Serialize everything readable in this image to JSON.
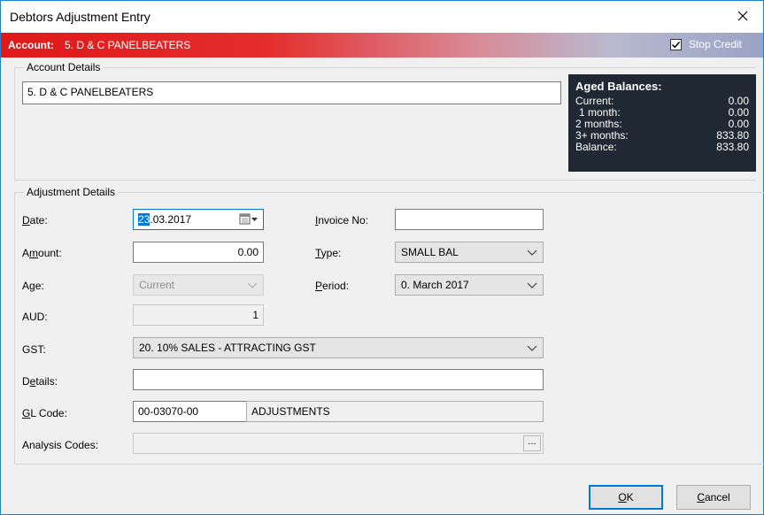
{
  "window": {
    "title": "Debtors Adjustment Entry"
  },
  "account_bar": {
    "label": "Account:",
    "name": "5. D & C PANELBEATERS",
    "stop_credit_label": "Stop Credit",
    "stop_credit_checked": true
  },
  "account_details": {
    "title": "Account Details",
    "name_value": "5. D & C PANELBEATERS"
  },
  "aged_balances": {
    "title": "Aged Balances:",
    "rows": [
      {
        "label": "Current:",
        "value": "0.00"
      },
      {
        "label": "1 month:",
        "value": "0.00"
      },
      {
        "label": "2 months:",
        "value": "0.00"
      },
      {
        "label": "3+ months:",
        "value": "833.80"
      },
      {
        "label": "Balance:",
        "value": "833.80"
      }
    ]
  },
  "adjustment": {
    "title": "Adjustment Details",
    "date_label": "Date:",
    "date_selected": "23",
    "date_rest": ".03.2017",
    "amount_label": "Amount:",
    "amount_value": "0.00",
    "age_label": "Age:",
    "age_value": "Current",
    "aud_label": "AUD:",
    "aud_value": "1",
    "gst_label": "GST:",
    "gst_value": "20. 10% SALES - ATTRACTING GST",
    "details_label": "Details:",
    "details_value": "",
    "gl_label": "GL Code:",
    "gl_code": "00-03070-00",
    "gl_desc": "ADJUSTMENTS",
    "analysis_label": "Analysis Codes:",
    "analysis_value": "",
    "analysis_button": "...",
    "invoice_label": "Invoice No:",
    "invoice_value": "",
    "type_label": "Type:",
    "type_value": "SMALL BAL",
    "period_label": "Period:",
    "period_value": "0. March 2017"
  },
  "buttons": {
    "ok": "OK",
    "cancel": "Cancel"
  }
}
